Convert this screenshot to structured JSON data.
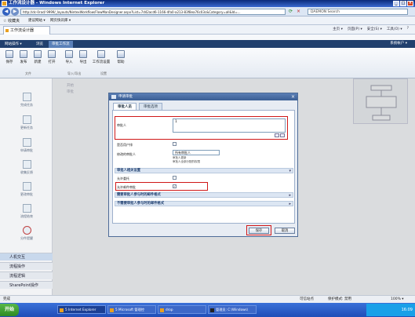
{
  "window": {
    "title": "工作流设计器 - Windows Internet Explorer"
  },
  "browser": {
    "address": "http://dc-0rad/ 9999/_layouts/NintexWorkflow/FlowManDesigner.aspx?List=7d42acd6-1166-4fa0-a213-83f8ea76c03c&Category=all&Id=...",
    "search_placeholder": "DAEMON Search",
    "favorites_label": "收藏夹",
    "fav_items": [
      "建议网站 ▾",
      "网页快讯库 ▾"
    ],
    "tab_label": "工作流设计器",
    "tools": [
      "主页 ▾",
      "页面(P) ▾",
      "安全(S) ▾",
      "工具(O) ▾",
      "?"
    ]
  },
  "sharepoint": {
    "tabs": [
      "网站操作 ▾",
      "浏览",
      "审批工作流"
    ],
    "account": "系统帐户 ▾"
  },
  "ribbon": {
    "buttons": [
      "保存",
      "发布",
      "新建",
      "打开",
      "导入",
      "导出",
      "工作流设置",
      "帮助"
    ],
    "groups": [
      "文件",
      "导入/导出",
      "设置"
    ]
  },
  "left_nav": {
    "items": [
      "完成任务",
      "更新任务",
      "申请审批",
      "收集反馈",
      "更改审批",
      "流程结束",
      "分件提醒"
    ],
    "bottom": [
      "人机交互",
      "流程操作",
      "流程逻辑",
      "SharePoint操作"
    ]
  },
  "canvas": {
    "lines": [
      "开始",
      "审批"
    ]
  },
  "dialog": {
    "title": "申请审批",
    "tabs": [
      "审批人员",
      "审批选项"
    ],
    "fields": {
      "approver_label": "审批人",
      "approver_value": "1",
      "allow_user_label": "是否用户排",
      "modify_label": "修改的审批人",
      "modify_select": "所有审批人",
      "modify_opt1": "审批人更新",
      "modify_opt2": "审批人全部分配的权限"
    },
    "sections": {
      "settings": "审批人相关设置",
      "email_required": "需要审批人参与时的邮件格式",
      "email_not_required": "不需要审批人参与时的邮件格式"
    },
    "checks": {
      "allow_label": "允许委托",
      "allow_checked": "",
      "email_label": "允许邮件审批",
      "email_checked": "✓"
    },
    "save_label": "保存",
    "cancel_label": "取消"
  },
  "status": {
    "left": "完成",
    "zone": "可信站点",
    "mode": "保护模式: 禁用",
    "zoom": "100% ▾"
  },
  "taskbar": {
    "start": "开始",
    "items": [
      "5 Internet Explorer",
      "5 Microsoft 管理控",
      "drop",
      "管理员: C:\\Windows\\"
    ],
    "clock": "16:09"
  }
}
